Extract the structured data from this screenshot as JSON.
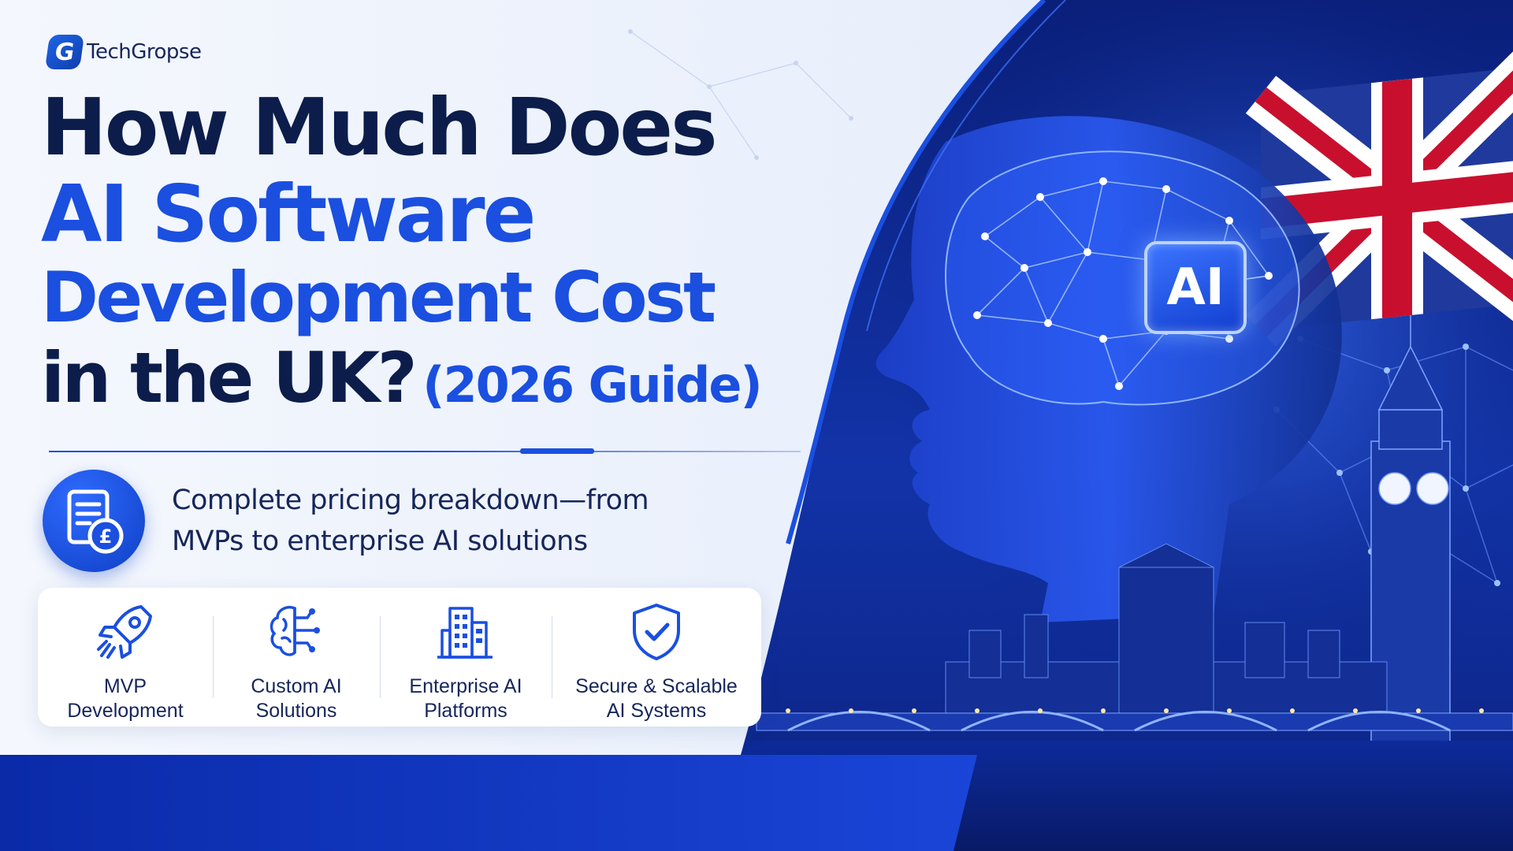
{
  "brand": {
    "logo_letter": "G",
    "name": "TechGropse",
    "logo_icon": "techgropse-logo-icon"
  },
  "headline": {
    "line1": "How Much Does",
    "line2": "AI Software",
    "line3": "Development Cost",
    "line4": "in the UK?",
    "guide": "(2026 Guide)"
  },
  "subtitle": {
    "icon": "pricing-document-pound-icon",
    "text_line1": "Complete pricing breakdown—from",
    "text_line2": "MVPs to enterprise AI solutions"
  },
  "features": [
    {
      "icon": "rocket-icon",
      "label": "MVP\nDevelopment"
    },
    {
      "icon": "brain-circuit-icon",
      "label": "Custom AI\nSolutions"
    },
    {
      "icon": "building-icon",
      "label": "Enterprise AI\nPlatforms"
    },
    {
      "icon": "shield-check-icon",
      "label": "Secure & Scalable\nAI Systems"
    }
  ],
  "hero": {
    "ai_badge": "AI",
    "scene": "ai-head-london-skyline"
  },
  "colors": {
    "navy": "#0c1d4b",
    "brand_blue": "#1a4fe0",
    "deep_blue": "#061a6b",
    "panel_bg": "#eef3fb",
    "flag_red": "#c8102e"
  }
}
